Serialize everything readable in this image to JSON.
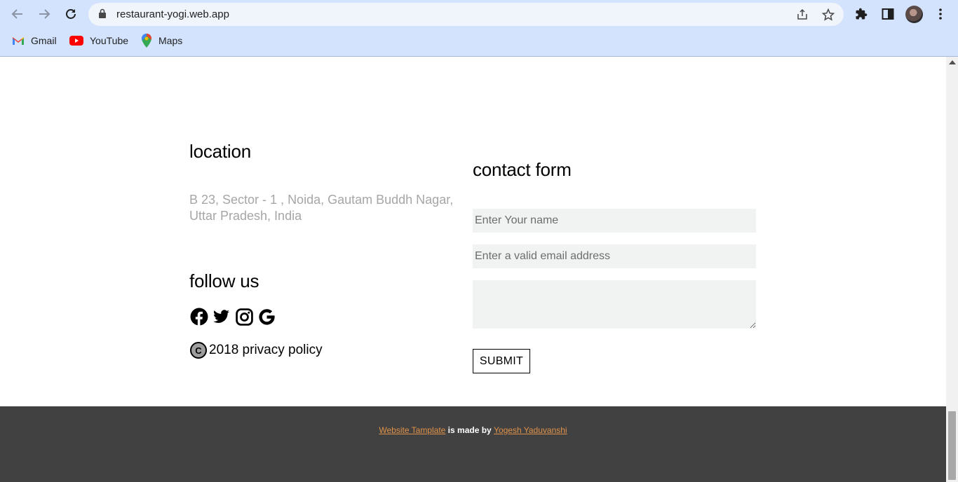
{
  "browser": {
    "url": "restaurant-yogi.web.app",
    "bookmarks": [
      {
        "label": "Gmail",
        "icon": "gmail-icon"
      },
      {
        "label": "YouTube",
        "icon": "youtube-icon"
      },
      {
        "label": "Maps",
        "icon": "maps-icon"
      }
    ]
  },
  "location": {
    "heading": "location",
    "address": "B 23, Sector - 1 , Noida, Gautam Buddh Nagar, Uttar Pradesh, India"
  },
  "follow": {
    "heading": "follow us",
    "icons": [
      "facebook-icon",
      "twitter-icon",
      "instagram-icon",
      "google-icon"
    ],
    "copyright_symbol": "C",
    "copyright_text": "2018 privacy policy"
  },
  "contact": {
    "heading": "contact form",
    "name_placeholder": "Enter Your name",
    "email_placeholder": "Enter a valid email address",
    "message_placeholder": "",
    "submit_label": "SUBMIT"
  },
  "footer": {
    "link1": "Website Tamplate",
    "middle": " is made by ",
    "link2": "Yogesh Yaduvanshi"
  },
  "colors": {
    "chrome_bg": "#d3e3fd",
    "footer_bg": "#414141",
    "footer_link": "#e0924a",
    "address_text": "#a6a6a6",
    "input_bg": "#f1f3f2"
  }
}
